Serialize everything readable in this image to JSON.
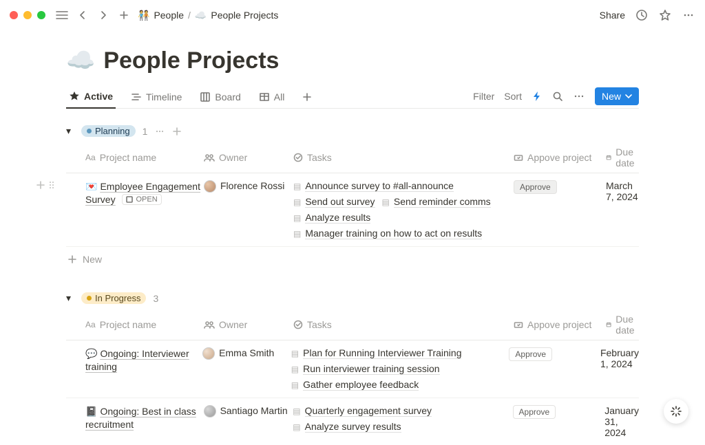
{
  "breadcrumb": {
    "parent": "People",
    "current": "People Projects"
  },
  "title": "People Projects",
  "topbar": {
    "share": "Share"
  },
  "views": {
    "tabs": [
      {
        "label": "Active"
      },
      {
        "label": "Timeline"
      },
      {
        "label": "Board"
      },
      {
        "label": "All"
      }
    ],
    "filter": "Filter",
    "sort": "Sort",
    "new": "New"
  },
  "columns": {
    "project": "Project name",
    "owner": "Owner",
    "tasks": "Tasks",
    "approve": "Appove project",
    "due": "Due date"
  },
  "groups": [
    {
      "name": "Planning",
      "count": "1",
      "rows": [
        {
          "emoji": "💌",
          "name": "Employee Engagement Survey",
          "open": "OPEN",
          "owner": "Florence Rossi",
          "tasks": [
            [
              "Announce survey to #all-announce"
            ],
            [
              "Send out survey",
              "Send reminder comms"
            ],
            [
              "Analyze results"
            ],
            [
              "Manager training on how to act on results"
            ]
          ],
          "approve": "Approve",
          "approve_active": true,
          "due": "March 7, 2024"
        }
      ],
      "new_label": "New"
    },
    {
      "name": "In Progress",
      "count": "3",
      "rows": [
        {
          "emoji": "💬",
          "name": "Ongoing: Interviewer training",
          "owner": "Emma Smith",
          "tasks": [
            [
              "Plan for Running Interviewer Training"
            ],
            [
              "Run interviewer training session"
            ],
            [
              "Gather employee feedback"
            ]
          ],
          "approve": "Approve",
          "due": "February 1, 2024"
        },
        {
          "emoji": "📓",
          "name": "Ongoing: Best in class recruitment",
          "owner": "Santiago Martin",
          "tasks": [
            [
              "Quarterly engagement survey"
            ],
            [
              "Analyze survey results"
            ]
          ],
          "approve": "Approve",
          "due": "January 31, 2024"
        }
      ]
    }
  ]
}
